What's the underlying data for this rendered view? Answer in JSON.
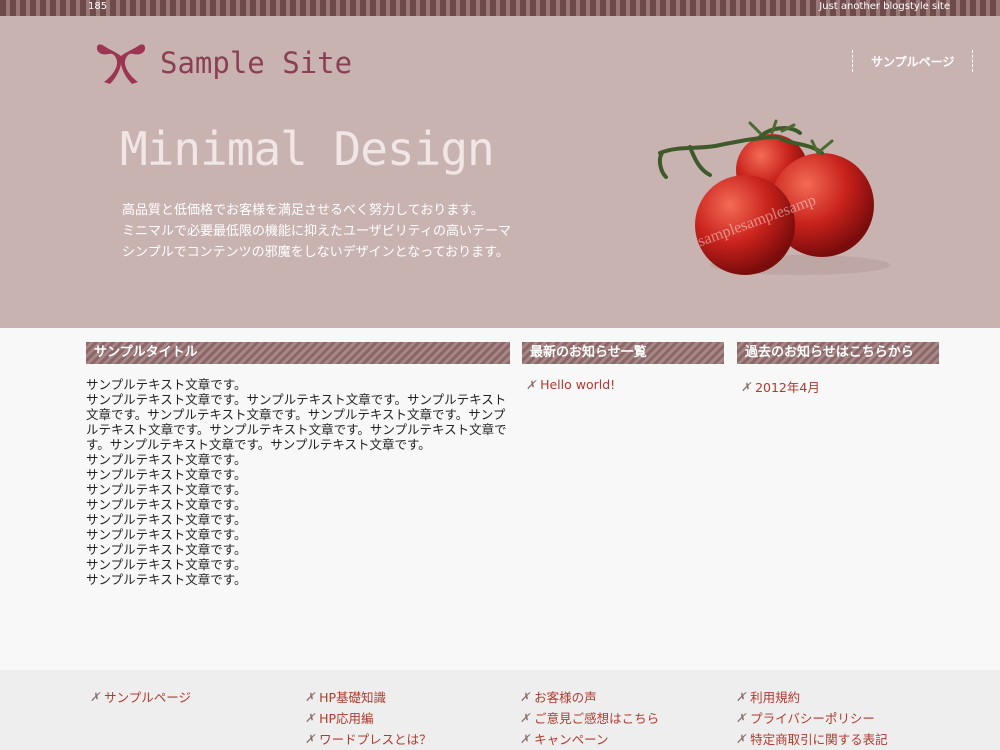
{
  "topbar": {
    "left_text": "185",
    "right_text": "Just another blogstyle site"
  },
  "header": {
    "logo_text": "Sample Site",
    "nav": [
      {
        "label": "サンプルページ"
      }
    ],
    "hero_title": "Minimal Design",
    "hero_lines": [
      "高品質と低価格でお客様を満足させるべく努力しております。",
      "ミニマルで必要最低限の機能に抑えたユーザビリティの高いテーマ",
      "シンプルでコンテンツの邪魔をしないデザインとなっております。"
    ],
    "watermark_text": "samplesamplesamp"
  },
  "main": {
    "title": "サンプルタイトル",
    "paragraphs": [
      "サンプルテキスト文章です。",
      "サンプルテキスト文章です。サンプルテキスト文章です。サンプルテキスト文章です。サンプルテキスト文章です。サンプルテキスト文章です。サンプルテキスト文章です。サンプルテキスト文章です。サンプルテキスト文章です。サンプルテキスト文章です。サンプルテキスト文章です。",
      "サンプルテキスト文章です。",
      "サンプルテキスト文章です。",
      "サンプルテキスト文章です。",
      "サンプルテキスト文章です。",
      "サンプルテキスト文章です。",
      "サンプルテキスト文章です。",
      "サンプルテキスト文章です。",
      "サンプルテキスト文章です。",
      "サンプルテキスト文章です。"
    ]
  },
  "sidebar": {
    "news": {
      "title": "最新のお知らせ一覧",
      "items": [
        "Hello world!"
      ]
    },
    "past": {
      "title": "過去のお知らせはこちらから",
      "items": [
        "2012年4月"
      ]
    }
  },
  "footer": {
    "columns": [
      [
        "サンプルページ"
      ],
      [
        "HP基礎知識",
        "HP応用編",
        "ワードプレスとは？"
      ],
      [
        "お客様の声",
        "ご意見ご感想はこちら",
        "キャンペーン"
      ],
      [
        "利用規約",
        "プライバシーポリシー",
        "特定商取引に関する表記"
      ]
    ]
  },
  "colors": {
    "header_bg": "#c9b3b1",
    "accent": "#8b3f55",
    "link": "#b03a2e",
    "stripe": "#8b6767"
  },
  "icons": {
    "logo": "ribbon-x-icon",
    "bullet": "ribbon-x-icon"
  }
}
